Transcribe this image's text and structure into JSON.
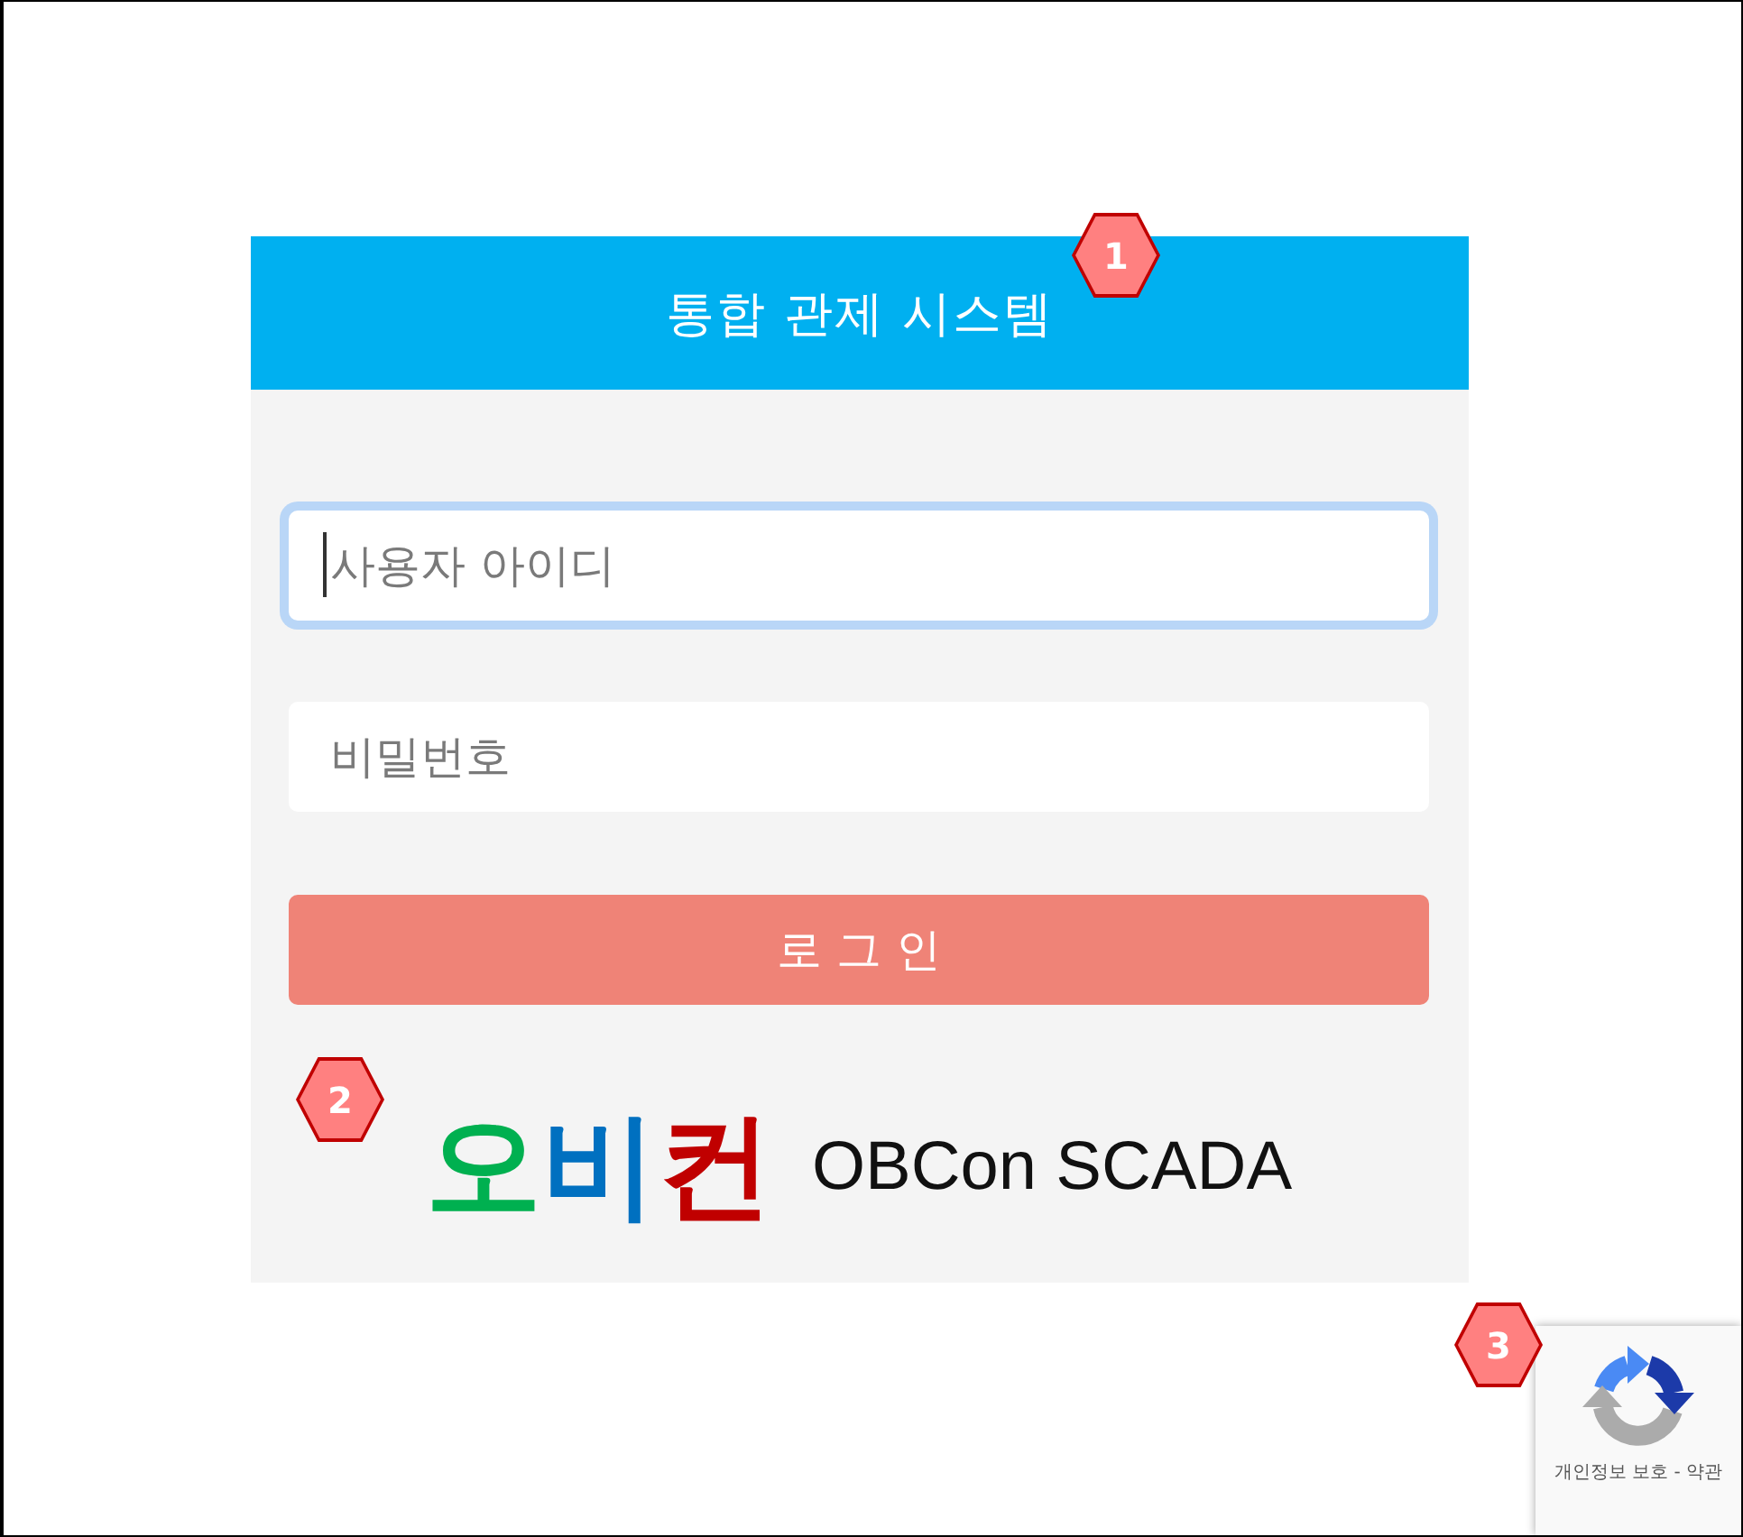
{
  "header": {
    "title": "통합 관제 시스템",
    "callout": "1"
  },
  "form": {
    "username": {
      "placeholder": "사용자 아이디",
      "focused": true
    },
    "password": {
      "placeholder": "비밀번호",
      "focused": false
    },
    "login_button": "로 그 인"
  },
  "logo": {
    "wordmark": [
      {
        "text": "오",
        "color": "#00b050"
      },
      {
        "text": "비",
        "color": "#0070c0"
      },
      {
        "text": "컨",
        "color": "#c00000"
      }
    ],
    "product": "OBCon SCADA",
    "callout": "2"
  },
  "recaptcha": {
    "links": "개인정보 보호 - 약관",
    "callout": "3"
  }
}
